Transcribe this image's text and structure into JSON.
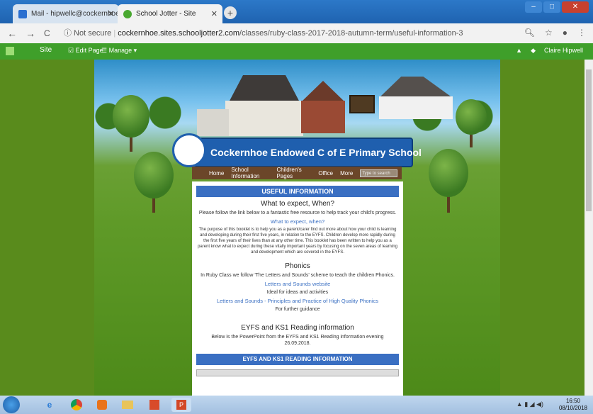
{
  "browser": {
    "tabs": [
      {
        "label": "Mail - hipwellc@cockernhoe.herts...",
        "active": false
      },
      {
        "label": "School Jotter - Site",
        "active": true
      }
    ],
    "nav": {
      "back": "←",
      "forward": "→",
      "reload": "C"
    },
    "security_label": "ⓘ Not secure",
    "url_host": "cockernhoe.sites.schooljotter2.com",
    "url_path": "/classes/ruby-class-2017-2018-autumn-term/useful-information-3"
  },
  "sitebar": {
    "site_label": "Site",
    "edit_label": "☑ Edit Page",
    "manage_label": "☰ Manage ▾",
    "user_label": "Claire Hipwell"
  },
  "school": {
    "name": "Cockernhoe Endowed C of E Primary School",
    "menu": [
      "Home",
      "School Information",
      "Children's Pages",
      "Office",
      "More"
    ],
    "search_placeholder": "Type to search"
  },
  "content": {
    "header": "USEFUL INFORMATION",
    "section1_title": "What to expect, When?",
    "section1_intro": "Please follow the link below to a fantastic free resource to help track your child's progress.",
    "section1_link": "What to expect, when?",
    "section1_body": "The purpose of this booklet is to help you as a parent/carer find out more about how your child is learning and developing during their first five years, in relation to the EYFS. Children develop more rapidly during the first five years of their lives than at any other time. This booklet has been written to help you as a parent know what to expect during these vitally important years by focusing on the seven areas of learning and development which are covered in the EYFS.",
    "section2_title": "Phonics",
    "section2_intro": "In Ruby Class we follow 'The Letters and Sounds' scheme to teach the children Phonics.",
    "section2_link1": "Letters and Sounds website",
    "section2_note1": "Ideal for ideas and activities",
    "section2_link2": "Letters and Sounds - Principles and Practice of High Quality Phonics",
    "section2_note2": "For further guidance",
    "section3_title": "EYFS and KS1 Reading information",
    "section3_intro": "Below is the PowerPoint from the EYFS and KS1 Reading information evening 26.09.2018.",
    "header2": "EYFS AND KS1 READING INFORMATION"
  },
  "taskbar": {
    "time": "16:50",
    "date": "08/10/2018"
  }
}
